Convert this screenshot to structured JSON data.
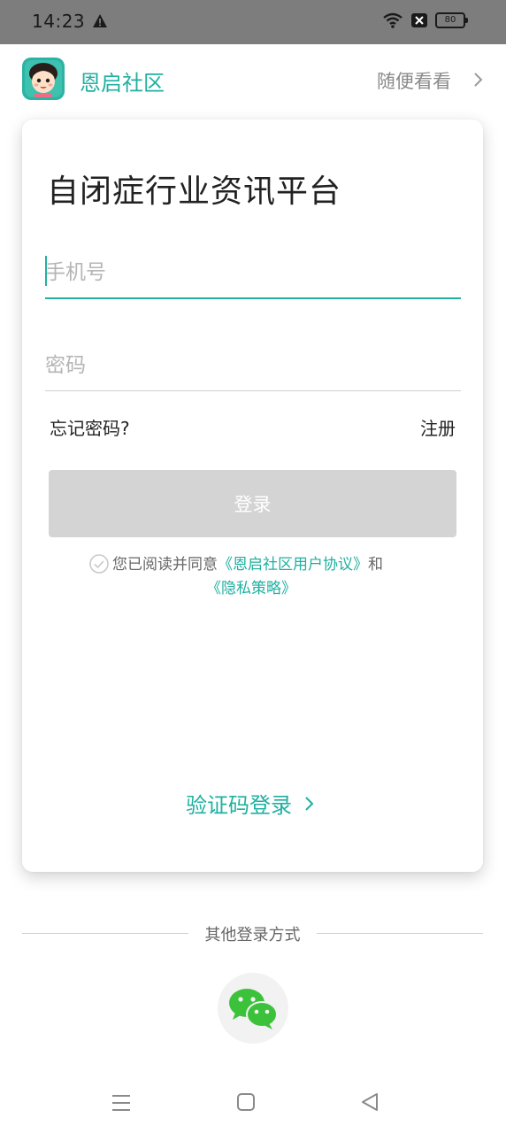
{
  "status_bar": {
    "time": "14:23",
    "battery": "80"
  },
  "header": {
    "app_name": "恩启社区",
    "browse_link": "随便看看",
    "logo_icon": "child-face-icon"
  },
  "login": {
    "title": "自闭症行业资讯平台",
    "phone_placeholder": "手机号",
    "password_placeholder": "密码",
    "forgot": "忘记密码?",
    "register": "注册",
    "login_button": "登录",
    "agree_prefix": "您已阅读并同意",
    "user_agreement": "《恩启社区用户协议》",
    "agree_and": "和",
    "privacy_policy": "《隐私策略》",
    "sms_login": "验证码登录"
  },
  "other": {
    "label": "其他登录方式",
    "wechat_icon": "wechat-icon"
  },
  "colors": {
    "accent": "#1fb0a0",
    "button_disabled": "#d4d4d4",
    "status_bar": "#7d7d7d",
    "wechat": "#3cc23a"
  }
}
